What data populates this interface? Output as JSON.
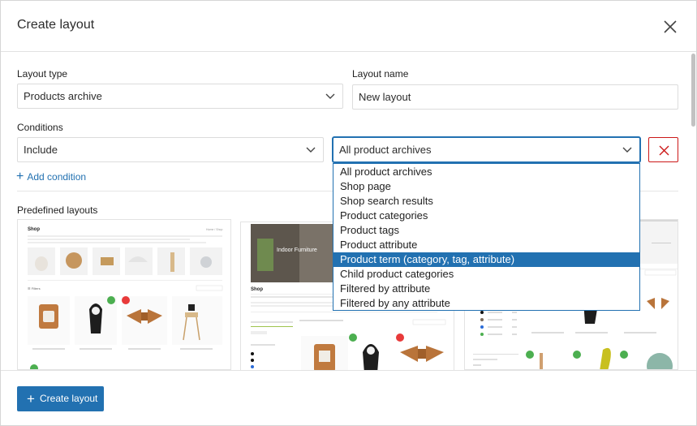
{
  "header": {
    "title": "Create layout"
  },
  "form": {
    "layout_type_label": "Layout type",
    "layout_type_value": "Products archive",
    "layout_name_label": "Layout name",
    "layout_name_value": "New layout",
    "conditions_label": "Conditions",
    "condition_mode_value": "Include",
    "condition_target_value": "All product archives",
    "add_condition_label": "Add condition"
  },
  "dropdown": {
    "options": [
      "All product archives",
      "Shop page",
      "Shop search results",
      "Product categories",
      "Product tags",
      "Product attribute",
      "Product term (category, tag, attribute)",
      "Child product categories",
      "Filtered by attribute",
      "Filtered by any attribute"
    ],
    "highlighted": "Product term (category, tag, attribute)"
  },
  "predefined": {
    "label": "Predefined layouts",
    "thumb1": {
      "title": "Shop",
      "breadcrumb": "Home / Shop"
    },
    "thumb2": {
      "hero": "Indoor Furniture",
      "title": "Shop"
    }
  },
  "footer": {
    "create_label": "Create layout"
  },
  "colors": {
    "accent": "#2271b1",
    "danger": "#cc1818",
    "sale": "#e83a3a",
    "new": "#4caf50"
  }
}
